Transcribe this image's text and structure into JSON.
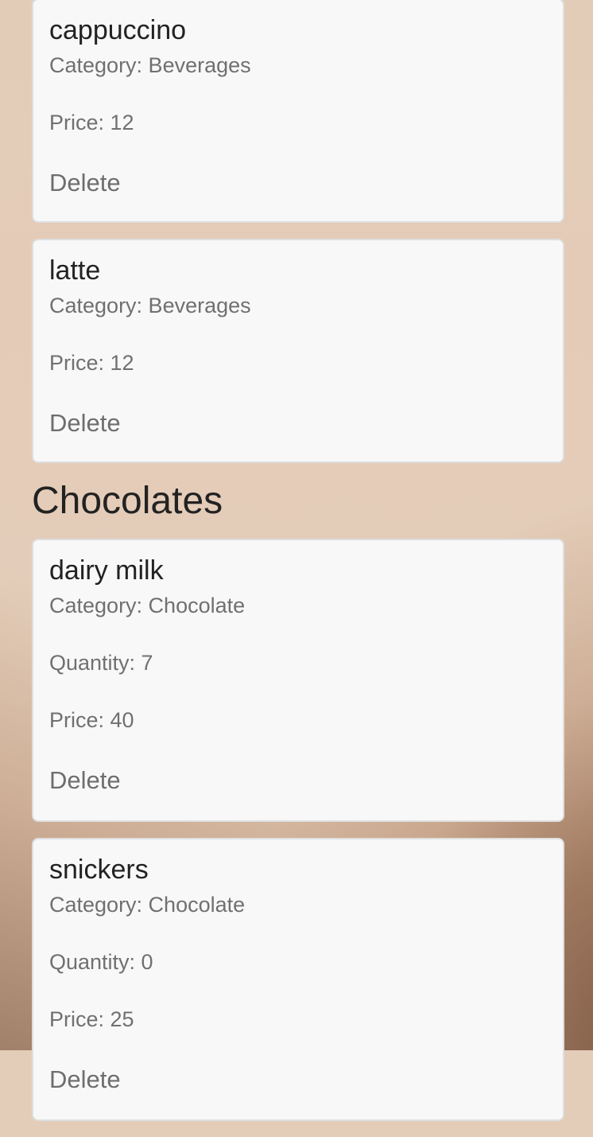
{
  "beverages": [
    {
      "name": "cappuccino",
      "category": "Category: Beverages",
      "price": "Price: 12",
      "delete_label": "Delete"
    },
    {
      "name": "latte",
      "category": "Category: Beverages",
      "price": "Price: 12",
      "delete_label": "Delete"
    }
  ],
  "chocolates_section": {
    "title": "Chocolates",
    "items": [
      {
        "name": "dairy milk",
        "category": "Category: Chocolate",
        "quantity": "Quantity: 7",
        "price": "Price: 40",
        "delete_label": "Delete"
      },
      {
        "name": "snickers",
        "category": "Category: Chocolate",
        "quantity": "Quantity: 0",
        "price": "Price: 25",
        "delete_label": "Delete"
      }
    ]
  }
}
